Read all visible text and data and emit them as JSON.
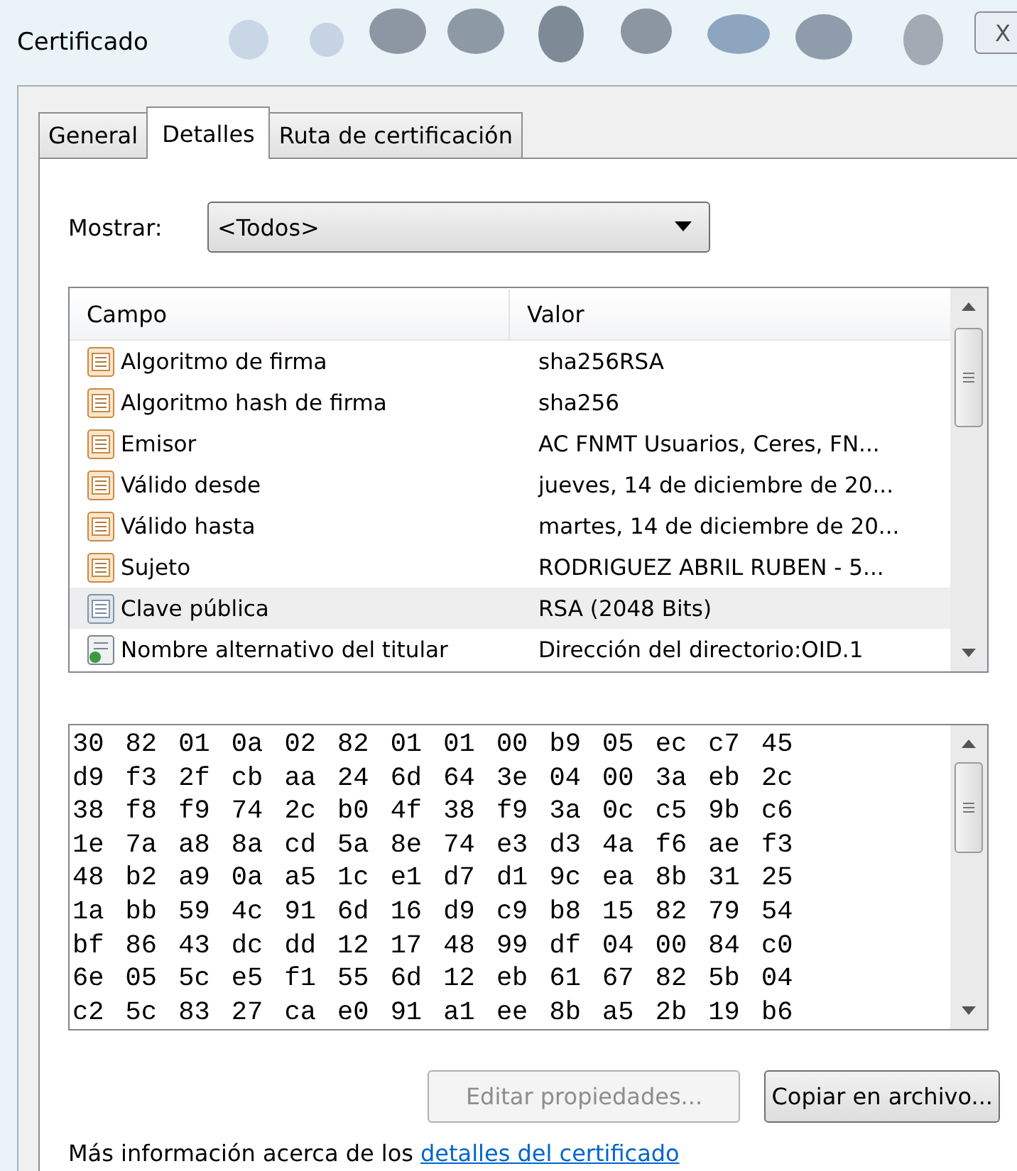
{
  "window": {
    "title": "Certificado",
    "close": "X"
  },
  "tabs": [
    {
      "label": "General",
      "selected": false
    },
    {
      "label": "Detalles",
      "selected": true
    },
    {
      "label": "Ruta de certificación",
      "selected": false
    }
  ],
  "show": {
    "label": "Mostrar:",
    "value": "<Todos>"
  },
  "fields": {
    "columns": [
      "Campo",
      "Valor"
    ],
    "rows": [
      {
        "kind": "property",
        "field": "Algoritmo de firma",
        "value": "sha256RSA",
        "selected": false
      },
      {
        "kind": "property",
        "field": "Algoritmo hash de firma",
        "value": "sha256",
        "selected": false
      },
      {
        "kind": "property",
        "field": "Emisor",
        "value": "AC FNMT Usuarios, Ceres, FN...",
        "selected": false
      },
      {
        "kind": "property",
        "field": "Válido desde",
        "value": "jueves, 14 de diciembre de 20...",
        "selected": false
      },
      {
        "kind": "property",
        "field": "Válido hasta",
        "value": "martes, 14 de diciembre de 20...",
        "selected": false
      },
      {
        "kind": "property",
        "field": "Sujeto",
        "value": "RODRIGUEZ ABRIL RUBEN - 5...",
        "selected": false
      },
      {
        "kind": "property",
        "field": "Clave pública",
        "value": "RSA (2048 Bits)",
        "selected": true
      },
      {
        "kind": "extension",
        "field": "Nombre alternativo del titular",
        "value": "Dirección del directorio:OID.1",
        "selected": false
      }
    ]
  },
  "hex_lines": [
    "30 82 01 0a 02 82 01 01 00 b9 05 ec c7 45",
    "d9 f3 2f cb aa 24 6d 64 3e 04 00 3a eb 2c",
    "38 f8 f9 74 2c b0 4f 38 f9 3a 0c c5 9b c6",
    "1e 7a a8 8a cd 5a 8e 74 e3 d3 4a f6 ae f3",
    "48 b2 a9 0a a5 1c e1 d7 d1 9c ea 8b 31 25",
    "1a bb 59 4c 91 6d 16 d9 c9 b8 15 82 79 54",
    "bf 86 43 dc dd 12 17 48 99 df 04 00 84 c0",
    "6e 05 5c e5 f1 55 6d 12 eb 61 67 82 5b 04",
    "c2 5c 83 27 ca e0 91 a1 ee 8b a5 2b 19 b6"
  ],
  "buttons": [
    {
      "label": "Editar propiedades...",
      "disabled": true
    },
    {
      "label": "Copiar en archivo...",
      "disabled": false
    }
  ],
  "footer": {
    "text": "Más información acerca de los",
    "link": "detalles del certificado"
  }
}
